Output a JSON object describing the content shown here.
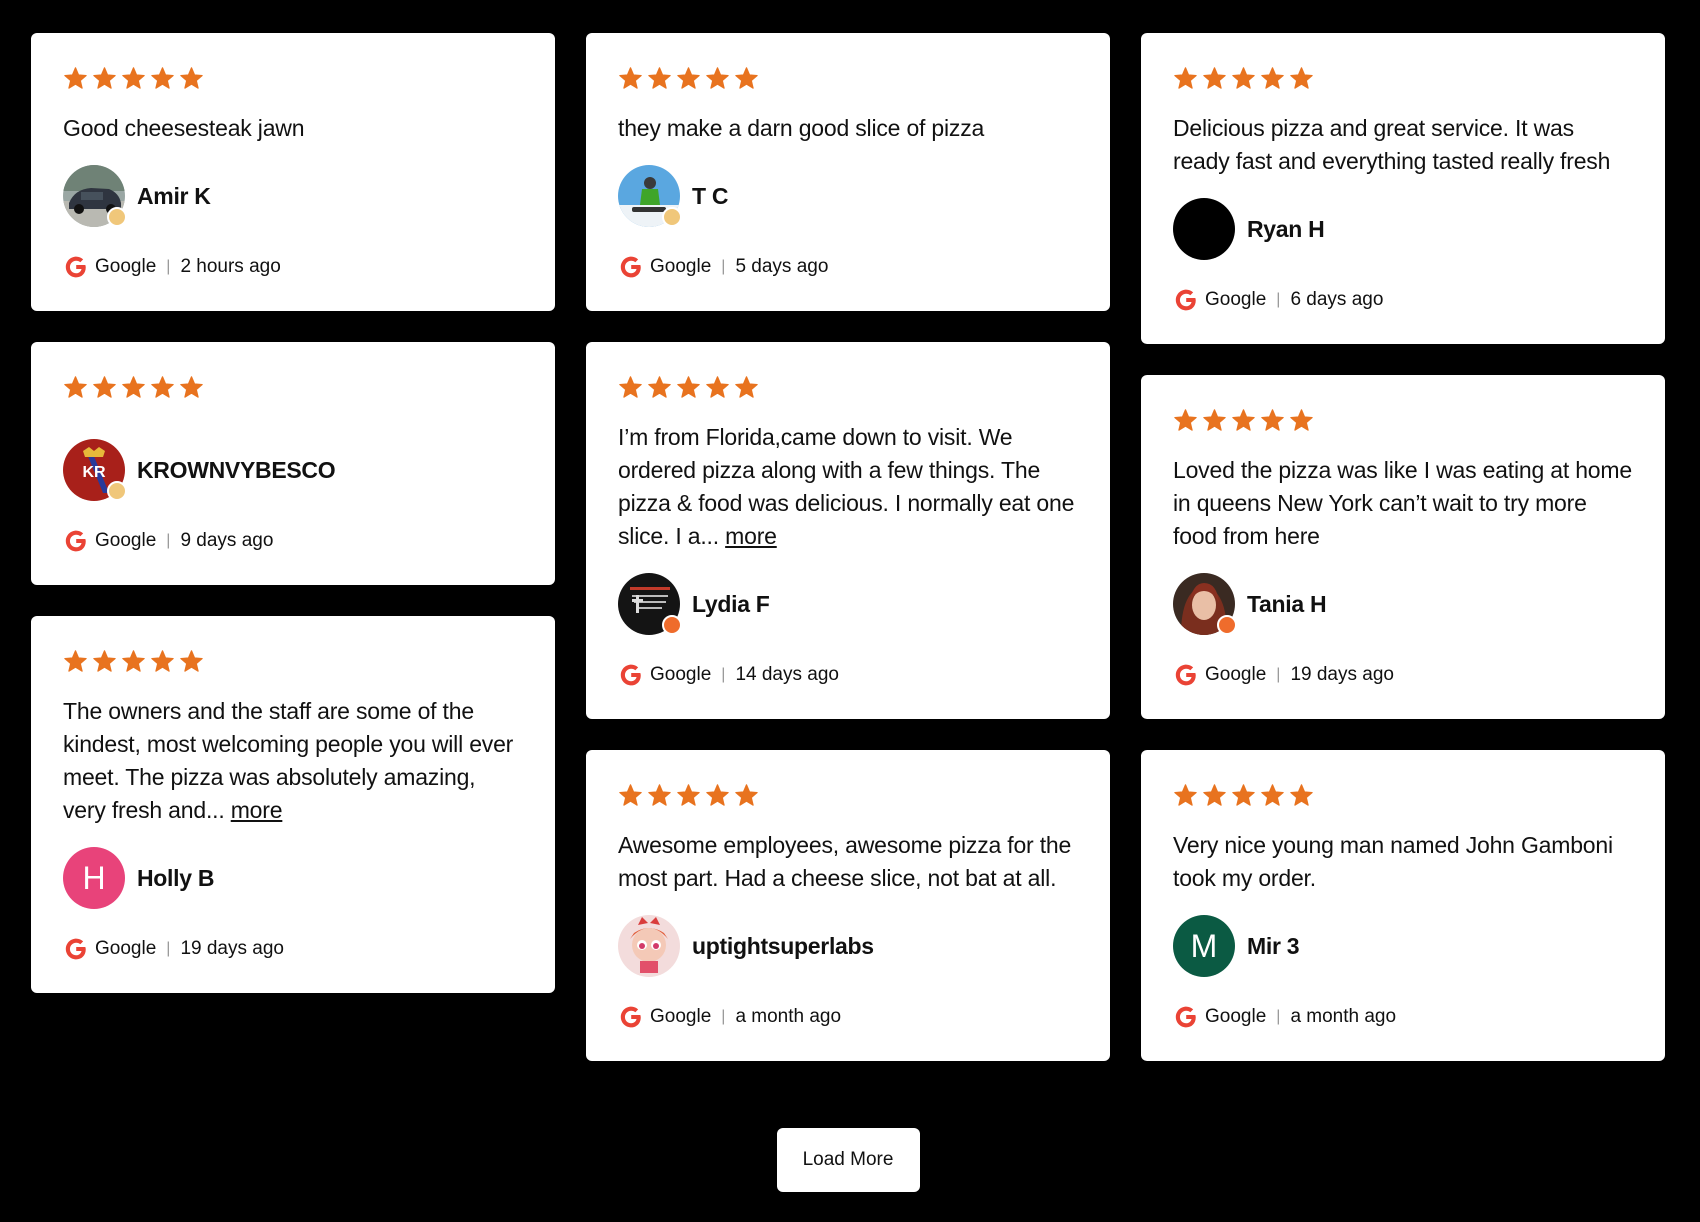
{
  "colors": {
    "star": "#e8731f",
    "google_red": "#ea4335",
    "background": "#000000",
    "card": "#ffffff"
  },
  "reviews": [
    {
      "id": "amir",
      "rating": 5,
      "text": "Good cheesesteak jawn",
      "more": "",
      "author": "Amir K",
      "avatar_type": "photo-car",
      "source": "Google",
      "time": "2 hours ago"
    },
    {
      "id": "krown",
      "rating": 5,
      "text": "",
      "more": "",
      "author": "KROWNVYBESCO",
      "avatar_type": "photo-kr-logo",
      "avatar_text": "KR",
      "source": "Google",
      "time": "9 days ago"
    },
    {
      "id": "holly",
      "rating": 5,
      "text": "The owners and the staff are some of the kindest, most welcoming people you will ever meet. The pizza was absolutely amazing, very fresh and...",
      "more": "more",
      "author": "Holly B",
      "avatar_type": "letter",
      "avatar_letter": "H",
      "avatar_color": "#e8437a",
      "source": "Google",
      "time": "19 days ago"
    },
    {
      "id": "tc",
      "rating": 5,
      "text": "they make a darn good slice of pizza",
      "more": "",
      "author": "T C",
      "avatar_type": "photo-snowboard",
      "source": "Google",
      "time": "5 days ago"
    },
    {
      "id": "lydia",
      "rating": 5,
      "text": "I’m from Florida,came down to visit. We ordered pizza along with a few things. The pizza & food was delicious. I normally eat one slice. I a...",
      "more": "more",
      "author": "Lydia F",
      "avatar_type": "photo-dark",
      "source": "Google",
      "time": "14 days ago"
    },
    {
      "id": "uptight",
      "rating": 5,
      "text": "Awesome employees, awesome pizza for the most part. Had a cheese slice, not bat at all.",
      "more": "",
      "author": "uptightsuperlabs",
      "avatar_type": "photo-cartoon",
      "source": "Google",
      "time": "a month ago"
    },
    {
      "id": "ryan",
      "rating": 5,
      "text": "Delicious pizza and great service. It was ready fast and everything tasted really fresh",
      "more": "",
      "author": "Ryan H",
      "avatar_type": "photo-black",
      "source": "Google",
      "time": "6 days ago"
    },
    {
      "id": "tania",
      "rating": 5,
      "text": "Loved the pizza was like I was eating at home in queens New York can’t wait to try more food from here",
      "more": "",
      "author": "Tania H",
      "avatar_type": "photo-portrait",
      "source": "Google",
      "time": "19 days ago"
    },
    {
      "id": "mir",
      "rating": 5,
      "text": "Very nice young man named John Gamboni took my order.",
      "more": "",
      "author": "Mir 3",
      "avatar_type": "letter",
      "avatar_letter": "M",
      "avatar_color": "#0b5a43",
      "source": "Google",
      "time": "a month ago"
    }
  ],
  "load_more": {
    "label": "Load More"
  }
}
